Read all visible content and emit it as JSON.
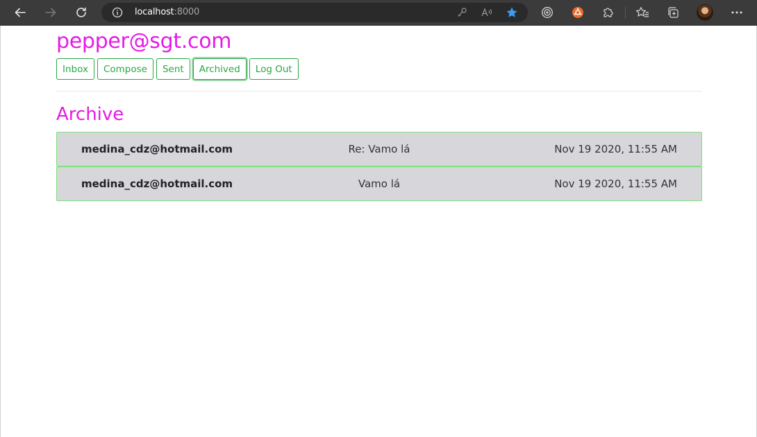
{
  "browser": {
    "url_host": "localhost",
    "url_port": ":8000",
    "icons": {
      "back": "back-arrow-icon",
      "forward": "forward-arrow-icon",
      "refresh": "refresh-icon",
      "info": "info-icon",
      "key": "key-icon",
      "read_aloud": "read-aloud-icon",
      "favorite": "favorite-star-icon",
      "tracking": "tracking-prevention-icon",
      "extension": "extension-orange-icon",
      "extensions": "extensions-puzzle-icon",
      "favorites": "favorites-icon",
      "collections": "collections-icon",
      "profile": "profile-avatar",
      "more": "more-icon"
    },
    "colors": {
      "chrome_bg": "#3b3b3b",
      "address_bg": "#2a2a2a",
      "star": "#3b9cf0",
      "ext_orange": "#ef6a2a"
    }
  },
  "header": {
    "user_email": "pepper@sgt.com",
    "buttons": [
      "Inbox",
      "Compose",
      "Sent",
      "Archived",
      "Log Out"
    ],
    "active_button": "Archived"
  },
  "view": {
    "title": "Archive"
  },
  "emails": [
    {
      "sender": "medina_cdz@hotmail.com",
      "subject": "Re: Vamo lá",
      "timestamp": "Nov 19 2020, 11:55 AM"
    },
    {
      "sender": "medina_cdz@hotmail.com",
      "subject": "Vamo lá",
      "timestamp": "Nov 19 2020, 11:55 AM"
    }
  ],
  "colors": {
    "accent_magenta": "#e61ae6",
    "button_green": "#28a745",
    "row_background": "#d7d7db",
    "row_border": "#7ee07e"
  }
}
